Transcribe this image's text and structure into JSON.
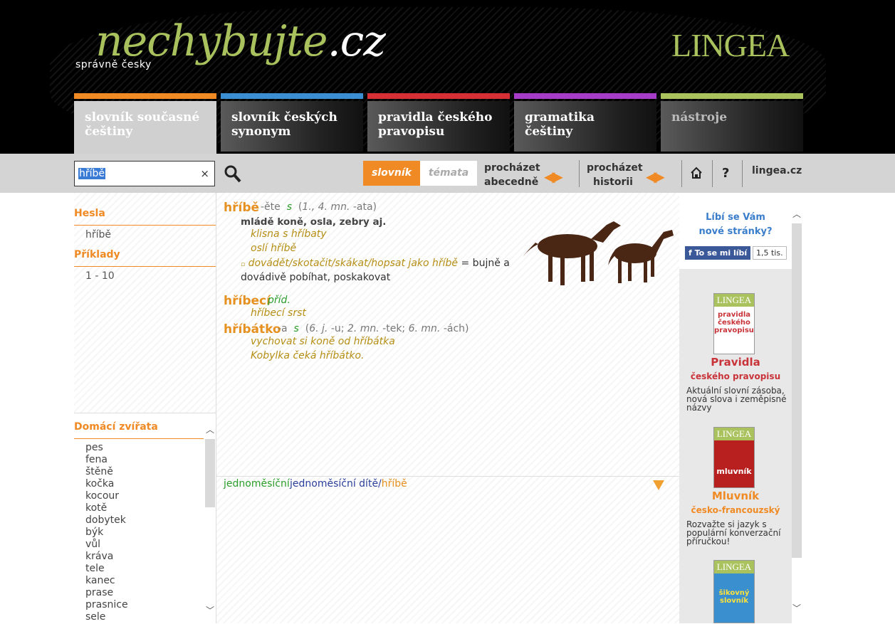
{
  "header": {
    "logo_main": "nechybujte",
    "logo_tld": ".cz",
    "logo_sub": "správně česky",
    "brand": "LINGEA"
  },
  "tabs": [
    {
      "label": "slovník současné češtiny",
      "color": "#f08a24"
    },
    {
      "label": "slovník českých synonym",
      "color": "#3b8ed1"
    },
    {
      "label": "pravidla českého pravopisu",
      "color": "#d62f35"
    },
    {
      "label": "gramatika češtiny",
      "color": "#a63cc8"
    },
    {
      "label": "nástroje",
      "color": "#a9c25d"
    }
  ],
  "toolbar": {
    "search_value": "hříbě",
    "clear": "×",
    "seg_active": "slovník",
    "seg_other": "témata",
    "browse_alpha_1": "procházet",
    "browse_alpha_2": "abecedně",
    "browse_hist_1": "procházet",
    "browse_hist_2": "historii",
    "help": "?",
    "link": "lingea.cz"
  },
  "left": {
    "hesla_title": "Hesla",
    "hesla_item": "hříbě",
    "priklady_title": "Příklady",
    "priklady_item": "1 - 10",
    "category_title": "Domácí zvířata",
    "category_items": [
      "pes",
      "fena",
      "štěně",
      "kočka",
      "kocour",
      "kotě",
      "dobytek",
      "býk",
      "vůl",
      "kráva",
      "tele",
      "kanec",
      "prase",
      "prasnice",
      "sele"
    ]
  },
  "entries": {
    "e1_head": "hříbě",
    "e1_g1": "-ěte",
    "e1_pos": "s",
    "e1_g2": "(",
    "e1_g3": "1., 4. mn.",
    "e1_g4": "-ata)",
    "e1_def": "mládě koně, osla, zebry aj.",
    "e1_ex1": "klisna s hříbaty",
    "e1_ex2": "oslí hříbě",
    "e1_idiom_mark": "▫",
    "e1_idiom": "dovádět/skotačit/skákat/hopsat jako hříbě",
    "e1_idiom_def1": "= bujně a",
    "e1_idiom_def2": "dovádivě pobíhat, poskakovat",
    "e2_head": "hříbecí",
    "e2_pos": "příd.",
    "e2_ex1": "hříbecí srst",
    "e3_head": "hříbátko",
    "e3_g1": "-a",
    "e3_pos": "s",
    "e3_g2": "(",
    "e3_g3": "6. j.",
    "e3_g4": "-u;",
    "e3_g5": "2. mn.",
    "e3_g6": "-tek;",
    "e3_g7": "6. mn.",
    "e3_g8": "-ách)",
    "e3_ex1": "vychovat si koně od hříbátka",
    "e3_ex2": "Kobylka čeká hříbátko."
  },
  "related": {
    "r1": "jednoměsíční",
    "r2": "jednoměsíční dítě/",
    "r3": "hříbě"
  },
  "sidebar": {
    "fb_q1": "Líbí se Vám",
    "fb_q2": "nové stránky?",
    "fb_button": "To se mi líbí",
    "fb_count": "1,5 tis.",
    "promo1_brand": "LINGEA",
    "promo1_book": "pravidla českého pravopisu",
    "promo1_title": "Pravidla",
    "promo1_sub": "českého pravopisu",
    "promo1_desc1": "Aktuální slovní zásoba,",
    "promo1_desc2": "nová slova i zeměpisné",
    "promo1_desc3": "názvy",
    "promo2_brand": "LINGEA",
    "promo2_book": "mluvník",
    "promo2_title": "Mluvník",
    "promo2_sub": "česko-francouzský",
    "promo2_desc1": "Rozvažte si jazyk s",
    "promo2_desc2": "populární konverzační",
    "promo2_desc3": "příručkou!",
    "promo3_brand": "LINGEA",
    "promo3_book": "šikovný slovník"
  }
}
